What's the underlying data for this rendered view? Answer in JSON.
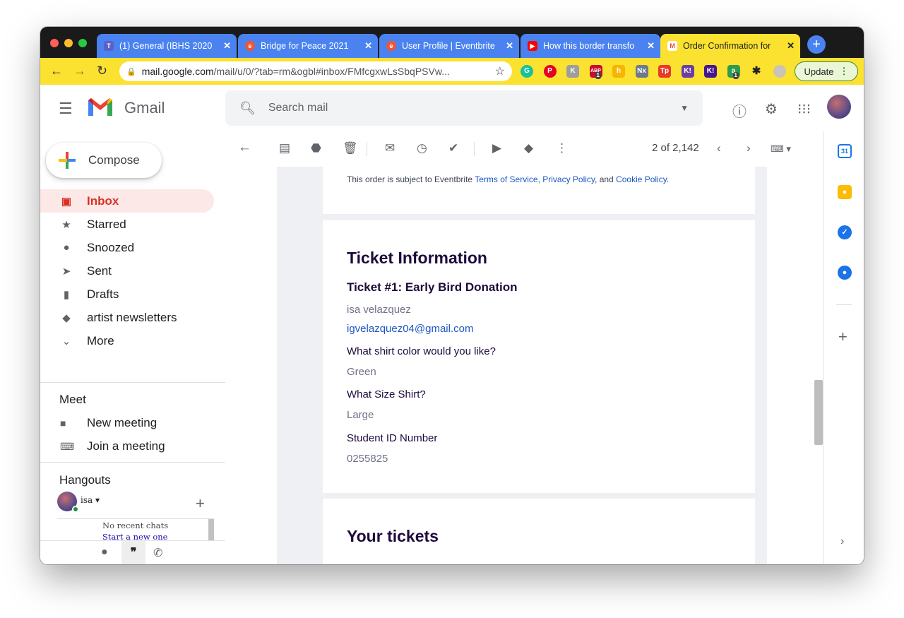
{
  "browser": {
    "tabs": [
      {
        "title": "(1) General (IBHS 2020",
        "favicon": "teams-icon",
        "color": "#5b5fc7",
        "active": false
      },
      {
        "title": "Bridge for Peace 2021",
        "favicon": "eventbrite-icon",
        "color": "#f05537",
        "active": false
      },
      {
        "title": "User Profile | Eventbrite",
        "favicon": "eventbrite-icon",
        "color": "#f05537",
        "active": false
      },
      {
        "title": "How this border transfo",
        "favicon": "youtube-icon",
        "color": "#ff0000",
        "active": false
      },
      {
        "title": "Order Confirmation for",
        "favicon": "gmail-icon",
        "color": "#ea4335",
        "active": true
      }
    ],
    "new_tab": "+",
    "url_host": "mail.google.com",
    "url_path": "/mail/u/0/?tab=rm&ogbl#inbox/FMfcgxwLsSbqPSVw...",
    "update_label": "Update",
    "extensions": [
      {
        "name": "grammarly-icon",
        "label": "G",
        "color": "#15c39a"
      },
      {
        "name": "pinterest-icon",
        "label": "P",
        "color": "#e60023"
      },
      {
        "name": "extension-k-icon",
        "label": "K",
        "color": "#9e9e9e"
      },
      {
        "name": "adblock-icon",
        "label": "ABP",
        "color": "#c70d2c",
        "badge": "1"
      },
      {
        "name": "honey-icon",
        "label": "h",
        "color": "#f7b500"
      },
      {
        "name": "nx-icon",
        "label": "Nx",
        "color": "#6b7b8c"
      },
      {
        "name": "tp-icon",
        "label": "Tp",
        "color": "#e8392b"
      },
      {
        "name": "kami-icon",
        "label": "K!",
        "color": "#6b3fa0"
      },
      {
        "name": "kahoot-icon",
        "label": "K!",
        "color": "#46178f"
      },
      {
        "name": "extension-a-icon",
        "label": "a",
        "color": "#2e9b4f",
        "badge": "1"
      },
      {
        "name": "puzzle-icon",
        "label": "✱",
        "color": "#333333"
      },
      {
        "name": "profile-icon",
        "label": "",
        "color": "#c9c3b8"
      }
    ]
  },
  "gmail": {
    "wordmark": "Gmail",
    "search_placeholder": "Search mail",
    "compose_label": "Compose",
    "nav": [
      {
        "label": "Inbox",
        "icon": "inbox-icon",
        "selected": true
      },
      {
        "label": "Starred",
        "icon": "star-icon",
        "selected": false
      },
      {
        "label": "Snoozed",
        "icon": "clock-icon",
        "selected": false
      },
      {
        "label": "Sent",
        "icon": "send-icon",
        "selected": false
      },
      {
        "label": "Drafts",
        "icon": "file-icon",
        "selected": false
      },
      {
        "label": "artist newsletters",
        "icon": "label-icon",
        "selected": false
      },
      {
        "label": "More",
        "icon": "chevron-down-icon",
        "selected": false
      }
    ],
    "meet": {
      "title": "Meet",
      "new_meeting": "New meeting",
      "join_meeting": "Join a meeting"
    },
    "hangouts": {
      "title": "Hangouts",
      "user": "isa",
      "no_chats": "No recent chats",
      "start_new": "Start a new one"
    },
    "pagination": "2 of 2,142"
  },
  "email": {
    "legal": {
      "prefix": "This order is subject to Eventbrite ",
      "terms": "Terms of Service",
      "sep1": ", ",
      "privacy": "Privacy Policy",
      "sep2": ", and ",
      "cookie": "Cookie Policy",
      "suffix": "."
    },
    "ticket_info_title": "Ticket Information",
    "ticket_name": "Ticket #1: Early Bird Donation",
    "attendee_name": "isa velazquez",
    "attendee_email": "igvelazquez04@gmail.com",
    "q1": "What shirt color would you like?",
    "a1": "Green",
    "q2": "What Size Shirt?",
    "a2": "Large",
    "q3": "Student ID Number",
    "a3": "0255825",
    "your_tickets_title": "Your tickets"
  },
  "side_panel": [
    {
      "name": "calendar-icon",
      "label": "31",
      "color": "#1a73e8"
    },
    {
      "name": "keep-icon",
      "label": "",
      "color": "#fbbc04"
    },
    {
      "name": "tasks-icon",
      "label": "✓",
      "color": "#1a73e8"
    },
    {
      "name": "contacts-icon",
      "label": "",
      "color": "#1a73e8"
    }
  ]
}
